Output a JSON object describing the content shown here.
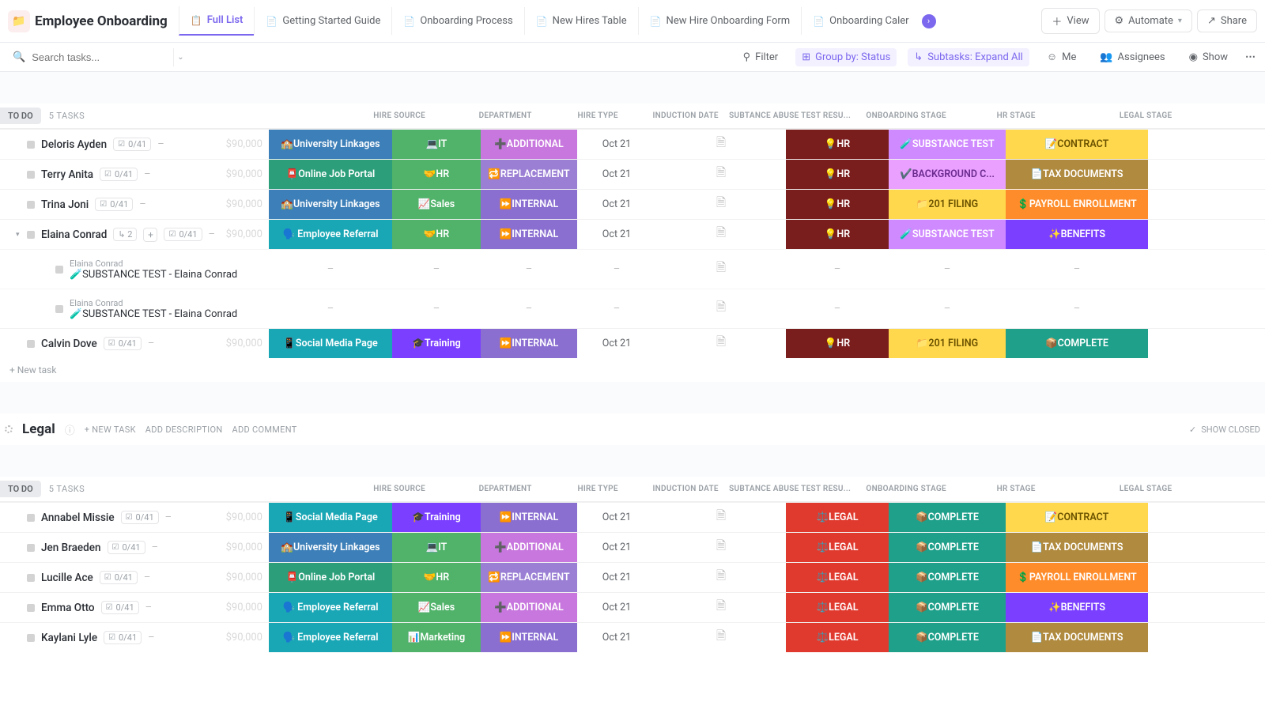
{
  "header": {
    "title": "Employee Onboarding",
    "tabs": [
      {
        "label": "Full List",
        "icon": "📋",
        "active": true
      },
      {
        "label": "Getting Started Guide",
        "icon": "📄"
      },
      {
        "label": "Onboarding Process",
        "icon": "📄"
      },
      {
        "label": "New Hires Table",
        "icon": "📄"
      },
      {
        "label": "New Hire Onboarding Form",
        "icon": "📄"
      },
      {
        "label": "Onboarding Caler",
        "icon": "📄",
        "truncated": true
      }
    ],
    "view": "View",
    "automate": "Automate",
    "share": "Share"
  },
  "toolbar": {
    "search_placeholder": "Search tasks...",
    "filter": "Filter",
    "group": "Group by: Status",
    "subtasks": "Subtasks: Expand All",
    "me": "Me",
    "assignees": "Assignees",
    "show": "Show"
  },
  "columns": [
    "HIRE SOURCE",
    "DEPARTMENT",
    "HIRE TYPE",
    "INDUCTION DATE",
    "SUBTANCE ABUSE TEST RESU...",
    "ONBOARDING STAGE",
    "HR STAGE",
    "LEGAL STAGE"
  ],
  "group1": {
    "badge": "TO DO",
    "count": "5 TASKS",
    "rows": [
      {
        "name": "Deloris Ayden",
        "prog": "0/41",
        "money": "$90,000",
        "hs": "🏫University Linkages",
        "hs_cls": "univ",
        "dept": "💻IT",
        "dept_cls": "it",
        "ht": "➕ADDITIONAL",
        "ht_cls": "additional",
        "date": "Oct 21",
        "stage": "💡HR",
        "stage_cls": "hrstage",
        "hrs": "🧪SUBSTANCE TEST",
        "hrs_cls": "subtest",
        "legal": "📝CONTRACT",
        "legal_cls": "contract"
      },
      {
        "name": "Terry Anita",
        "prog": "0/41",
        "money": "$90,000",
        "hs": "📮Online Job Portal",
        "hs_cls": "portal",
        "dept": "🤝HR",
        "dept_cls": "hr",
        "ht": "🔁REPLACEMENT",
        "ht_cls": "replacement",
        "date": "Oct 21",
        "stage": "💡HR",
        "stage_cls": "hrstage",
        "hrs": "✔️BACKGROUND C...",
        "hrs_cls": "bgcheck",
        "legal": "📄TAX DOCUMENTS",
        "legal_cls": "taxdoc"
      },
      {
        "name": "Trina Joni",
        "prog": "0/41",
        "money": "$90,000",
        "hs": "🏫University Linkages",
        "hs_cls": "univ",
        "dept": "📈Sales",
        "dept_cls": "sales",
        "ht": "⏩INTERNAL",
        "ht_cls": "internal",
        "date": "Oct 21",
        "stage": "💡HR",
        "stage_cls": "hrstage",
        "hrs": "📁201 FILING",
        "hrs_cls": "filing",
        "legal": "💲PAYROLL ENROLLMENT",
        "legal_cls": "payroll"
      },
      {
        "name": "Elaina Conrad",
        "prog": "0/41",
        "money": "$90,000",
        "hs": "🗣️ Employee Referral",
        "hs_cls": "referral",
        "dept": "🤝HR",
        "dept_cls": "hr",
        "ht": "⏩INTERNAL",
        "ht_cls": "internal",
        "date": "Oct 21",
        "stage": "💡HR",
        "stage_cls": "hrstage",
        "hrs": "🧪SUBSTANCE TEST",
        "hrs_cls": "subtest",
        "legal": "✨BENEFITS",
        "legal_cls": "benefits",
        "sub_count": "2",
        "expanded": true
      },
      {
        "name": "Calvin Dove",
        "prog": "0/41",
        "money": "$90,000",
        "hs": "📱Social Media Page",
        "hs_cls": "social",
        "dept": "🎓Training",
        "dept_cls": "training",
        "ht": "⏩INTERNAL",
        "ht_cls": "internal",
        "date": "Oct 21",
        "stage": "💡HR",
        "stage_cls": "hrstage",
        "hrs": "📁201 FILING",
        "hrs_cls": "filing",
        "legal": "📦COMPLETE",
        "legal_cls": "complete"
      }
    ],
    "subtasks": [
      {
        "parent": "Elaina Conrad",
        "title": "🧪SUBSTANCE TEST - Elaina Conrad"
      },
      {
        "parent": "Elaina Conrad",
        "title": "🧪SUBSTANCE TEST - Elaina Conrad"
      }
    ],
    "newtask": "+ New task"
  },
  "legal_section": {
    "title": "Legal",
    "new_task": "+ NEW TASK",
    "add_desc": "ADD DESCRIPTION",
    "add_comment": "ADD COMMENT",
    "show_closed": "SHOW CLOSED"
  },
  "group2": {
    "badge": "TO DO",
    "count": "5 TASKS",
    "rows": [
      {
        "name": "Annabel Missie",
        "prog": "0/41",
        "money": "$90,000",
        "hs": "📱Social Media Page",
        "hs_cls": "social",
        "dept": "🎓Training",
        "dept_cls": "training",
        "ht": "⏩INTERNAL",
        "ht_cls": "internal",
        "date": "Oct 21",
        "stage": "⚖️LEGAL",
        "stage_cls": "legal",
        "hrs": "📦COMPLETE",
        "hrs_cls": "complete",
        "legal": "📝CONTRACT",
        "legal_cls": "contract"
      },
      {
        "name": "Jen Braeden",
        "prog": "0/41",
        "money": "$90,000",
        "hs": "🏫University Linkages",
        "hs_cls": "univ",
        "dept": "💻IT",
        "dept_cls": "it",
        "ht": "➕ADDITIONAL",
        "ht_cls": "additional",
        "date": "Oct 21",
        "stage": "⚖️LEGAL",
        "stage_cls": "legal",
        "hrs": "📦COMPLETE",
        "hrs_cls": "complete",
        "legal": "📄TAX DOCUMENTS",
        "legal_cls": "taxdoc"
      },
      {
        "name": "Lucille Ace",
        "prog": "0/41",
        "money": "$90,000",
        "hs": "📮Online Job Portal",
        "hs_cls": "portal",
        "dept": "🤝HR",
        "dept_cls": "hr",
        "ht": "🔁REPLACEMENT",
        "ht_cls": "replacement",
        "date": "Oct 21",
        "stage": "⚖️LEGAL",
        "stage_cls": "legal",
        "hrs": "📦COMPLETE",
        "hrs_cls": "complete",
        "legal": "💲PAYROLL ENROLLMENT",
        "legal_cls": "payroll"
      },
      {
        "name": "Emma Otto",
        "prog": "0/41",
        "money": "$90,000",
        "hs": "🗣️ Employee Referral",
        "hs_cls": "referral",
        "dept": "📈Sales",
        "dept_cls": "sales",
        "ht": "➕ADDITIONAL",
        "ht_cls": "additional",
        "date": "Oct 21",
        "stage": "⚖️LEGAL",
        "stage_cls": "legal",
        "hrs": "📦COMPLETE",
        "hrs_cls": "complete",
        "legal": "✨BENEFITS",
        "legal_cls": "benefits"
      },
      {
        "name": "Kaylani Lyle",
        "prog": "0/41",
        "money": "$90,000",
        "hs": "🗣️ Employee Referral",
        "hs_cls": "referral",
        "dept": "📊Marketing",
        "dept_cls": "marketing",
        "ht": "⏩INTERNAL",
        "ht_cls": "internal",
        "date": "Oct 21",
        "stage": "⚖️LEGAL",
        "stage_cls": "legal",
        "hrs": "📦COMPLETE",
        "hrs_cls": "complete",
        "legal": "📄TAX DOCUMENTS",
        "legal_cls": "taxdoc"
      }
    ]
  }
}
